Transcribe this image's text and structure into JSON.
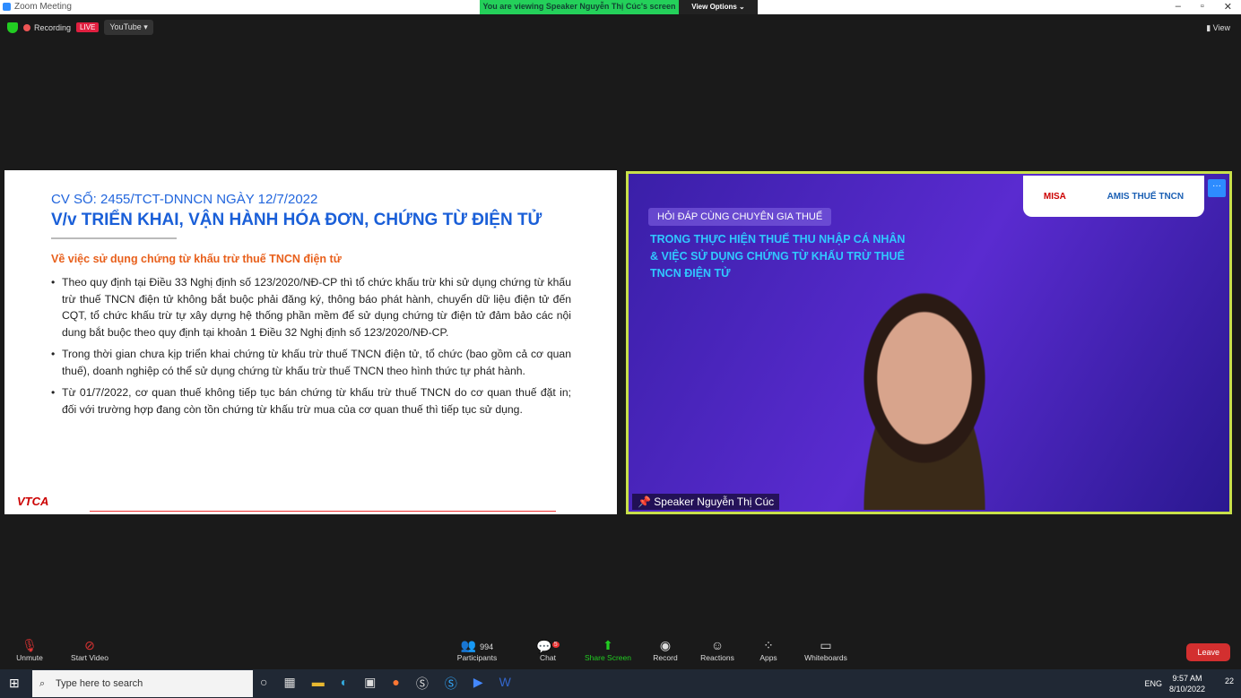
{
  "window": {
    "title": "Zoom Meeting",
    "banner": "You are viewing Speaker Nguyễn Thị Cúc's screen",
    "view_options": "View Options ⌄",
    "controls": [
      "–",
      "▫",
      "✕"
    ]
  },
  "topbar": {
    "recording": "Recording",
    "live": "LIVE",
    "stream": "YouTube ▾",
    "view": "▮ View"
  },
  "slide": {
    "cv": "CV SỐ: 2455/TCT-DNNCN NGÀY 12/7/2022",
    "heading": "V/v TRIỂN KHAI, VẬN HÀNH HÓA ĐƠN, CHỨNG TỪ ĐIỆN TỬ",
    "subheading": "Về việc sử dụng chứng từ khấu trừ thuế TNCN điện tử",
    "bullets": [
      "Theo quy định tại Điều 33 Nghị định số 123/2020/NĐ-CP thì tổ chức khấu trừ khi sử dụng chứng từ khấu trừ thuế TNCN điện tử không bắt buộc phải đăng ký, thông báo phát hành, chuyển dữ liệu điện tử đến CQT, tổ chức khấu trừ tự xây dựng hệ thống phần mềm để sử dụng chứng từ điện tử đảm bảo các nội dung bắt buộc theo quy định tại khoản 1 Điều 32 Nghị định số 123/2020/NĐ-CP.",
      "Trong thời gian chưa kịp triển khai chứng từ khấu trừ thuế TNCN điện tử, tổ chức (bao gồm cả cơ quan thuế), doanh nghiệp có thể sử dụng chứng từ khấu trừ thuế TNCN theo hình thức tự phát hành.",
      "Từ 01/7/2022, cơ quan thuế không tiếp tục bán chứng từ khấu trừ thuế TNCN do cơ quan thuế đặt in; đối với trường hợp đang còn tồn chứng từ khấu trừ mua của cơ quan thuế thì tiếp tục sử dụng."
    ],
    "logo": "VTCA"
  },
  "video": {
    "pill": "HỎI ĐÁP CÙNG CHUYÊN GIA THUẾ",
    "lines": [
      "TRONG THỰC HIỆN THUẾ THU NHẬP CÁ NHÂN",
      "& VIỆC SỬ DỤNG CHỨNG TỪ KHẤU TRỪ THUẾ",
      "TNCN ĐIỆN TỬ"
    ],
    "logo1": "MISA",
    "logo2": "AMIS THUẾ TNCN",
    "more": "···",
    "name": "Speaker Nguyễn Thị Cúc"
  },
  "toolbar": {
    "unmute": "Unmute",
    "start_video": "Start Video",
    "participants": "Participants",
    "participant_count": "994",
    "chat": "Chat",
    "chat_badge": "5",
    "share": "Share Screen",
    "record": "Record",
    "reactions": "Reactions",
    "apps": "Apps",
    "whiteboards": "Whiteboards",
    "leave": "Leave"
  },
  "taskbar": {
    "search_placeholder": "Type here to search",
    "lang": "ENG",
    "time": "9:57 AM",
    "date": "8/10/2022",
    "notif": "22"
  }
}
